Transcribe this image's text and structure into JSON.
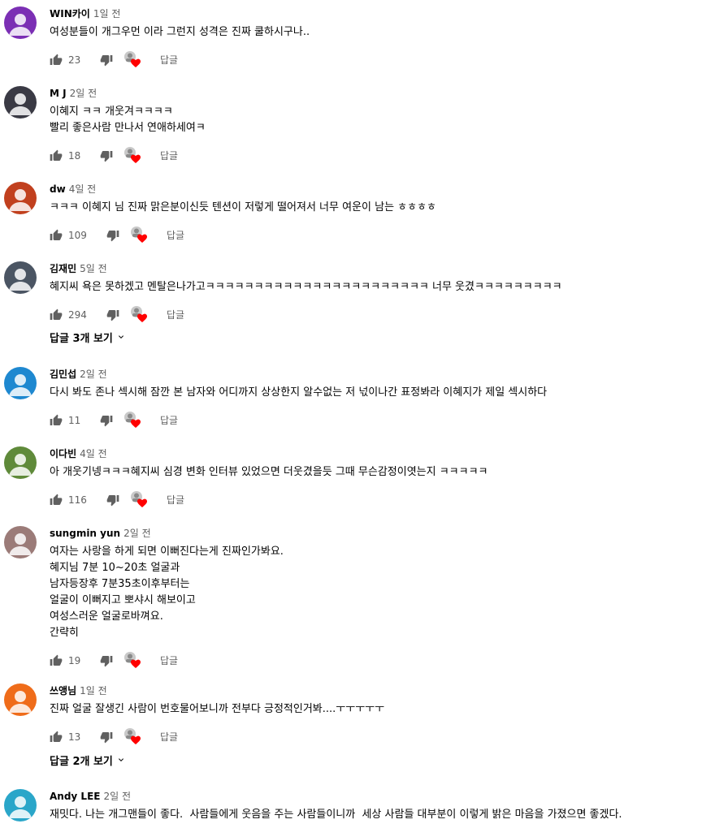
{
  "comments": [
    {
      "author": "WIN카이",
      "time": "1일 전",
      "text": "여성분들이 개그우먼 이라 그런지 성격은 진짜 쿨하시구나..",
      "likes": "23",
      "reply": "답글",
      "avatar_color": "#7b2fb4"
    },
    {
      "author": "M J",
      "time": "2일 전",
      "text": "이혜지 ㅋㅋ 개웃겨ㅋㅋㅋㅋ\n빨리 좋은사람 만나서 연애하세여ㅋ",
      "likes": "18",
      "reply": "답글",
      "avatar_color": "#3a3a44"
    },
    {
      "author": "dw",
      "time": "4일 전",
      "text": "ㅋㅋㅋ 이혜지 님 진짜 맑은분이신듯 텐션이 저렇게 떨어져서 너무 여운이 남는 ㅎㅎㅎㅎ",
      "likes": "109",
      "reply": "답글",
      "avatar_color": "#c1401e"
    },
    {
      "author": "김재민",
      "time": "5일 전",
      "text": "혜지씨 욕은 못하겠고 멘탈은나가고ㅋㅋㅋㅋㅋㅋㅋㅋㅋㅋㅋㅋㅋㅋㅋㅋㅋㅋㅋㅋㅋㅋㅋ 너무 웃겼ㅋㅋㅋㅋㅋㅋㅋㅋㅋ",
      "likes": "294",
      "reply": "답글",
      "avatar_color": "#4b5563",
      "replies": "답글 3개 보기"
    },
    {
      "author": "김민섭",
      "time": "2일 전",
      "text": "다시 봐도 존나 섹시해 잠깐 본 남자와 어디까지 상상한지 알수없는 저 넋이나간 표정봐라 이혜지가 제일 섹시하다",
      "likes": "11",
      "reply": "답글",
      "avatar_color": "#1e88d0"
    },
    {
      "author": "이다빈",
      "time": "4일 전",
      "text": "아 개웃기넹ㅋㅋㅋ혜지씨 심경 변화 인터뷰 있었으면 더웃겼을듯 그때 무슨감정이엿는지 ㅋㅋㅋㅋㅋ",
      "likes": "116",
      "reply": "답글",
      "avatar_color": "#5f8a3a"
    },
    {
      "author": "sungmin yun",
      "time": "2일 전",
      "text": "여자는 사랑을 하게 되면 이뻐진다는게 진짜인가봐요.\n혜지님 7분 10~20초 얼굴과\n남자등장후 7분35초이후부터는\n얼굴이 이뻐지고 뽀샤시 해보이고\n여성스러운 얼굴로바껴요.\n간략히",
      "likes": "19",
      "reply": "답글",
      "avatar_color": "#9b7b78"
    },
    {
      "author": "쓰앵님",
      "time": "1일 전",
      "text": "진짜 얼굴 잘생긴 사람이 번호물어보니까 전부다 긍정적인거봐....ㅜㅜㅜㅜㅜ",
      "likes": "13",
      "reply": "답글",
      "avatar_color": "#ef6c1a",
      "replies": "답글 2개 보기"
    },
    {
      "author": "Andy LEE",
      "time": "2일 전",
      "text": "재밋다. 나는 개그맨들이 좋다.  사람들에게 웃음을 주는 사람들이니까  세상 사람들 대부분이 이렇게 밝은 마음을 가졌으면 좋겠다.",
      "likes": "",
      "reply": "",
      "avatar_color": "#2aa6c9"
    }
  ],
  "icons": {
    "like": "thumbs-up-icon",
    "dislike": "thumbs-down-icon",
    "creator_heart": "creator-heart-icon",
    "expand": "chevron-down-icon"
  },
  "colors": {
    "heart": "#ff0000",
    "secondary_text": "#606060"
  }
}
